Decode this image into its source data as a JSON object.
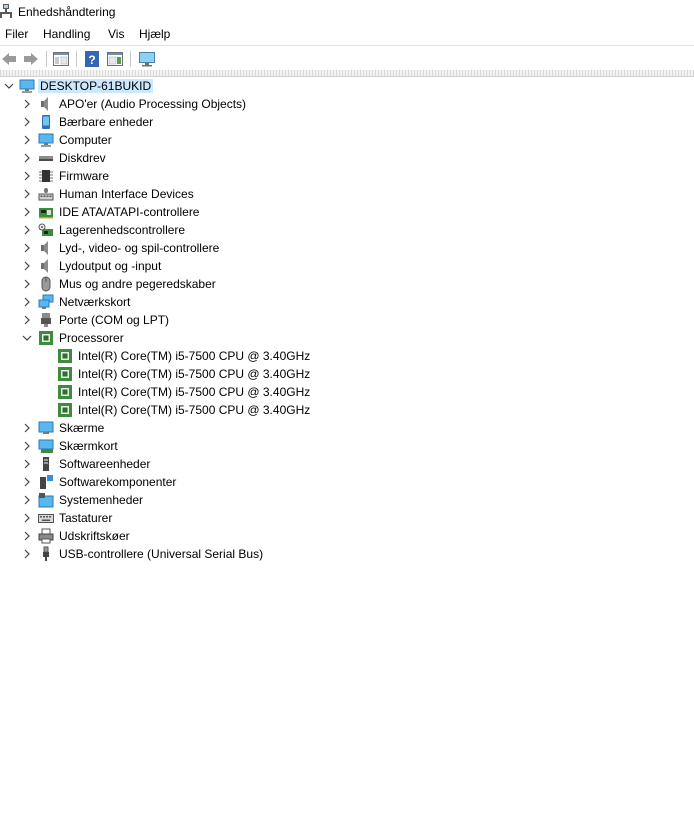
{
  "window": {
    "title": "Enhedshåndtering",
    "icon": "device-manager-icon"
  },
  "menu": [
    "Filer",
    "Handling",
    "Vis",
    "Hjælp"
  ],
  "toolbar": [
    {
      "name": "back-icon"
    },
    {
      "name": "forward-icon"
    },
    {
      "name": "properties-pane-icon"
    },
    {
      "name": "help-icon"
    },
    {
      "name": "action-pane-icon"
    },
    {
      "name": "scan-hardware-monitor-icon"
    }
  ],
  "tree": {
    "root": {
      "label": "DESKTOP-61BUKID",
      "icon": "computer-monitor-icon",
      "expanded": true
    },
    "categories": [
      {
        "label": "APO'er (Audio Processing Objects)",
        "icon": "speaker-icon"
      },
      {
        "label": "Bærbare enheder",
        "icon": "portable-device-icon"
      },
      {
        "label": "Computer",
        "icon": "computer-monitor-icon"
      },
      {
        "label": "Diskdrev",
        "icon": "disk-drive-icon"
      },
      {
        "label": "Firmware",
        "icon": "firmware-chip-icon"
      },
      {
        "label": "Human Interface Devices",
        "icon": "keyboard-hid-icon"
      },
      {
        "label": "IDE ATA/ATAPI-controllere",
        "icon": "ide-controller-icon"
      },
      {
        "label": "Lagerenhedscontrollere",
        "icon": "storage-controller-icon"
      },
      {
        "label": "Lyd-, video- og spil-controllere",
        "icon": "speaker-icon"
      },
      {
        "label": "Lydoutput og -input",
        "icon": "speaker-icon"
      },
      {
        "label": "Mus og andre pegeredskaber",
        "icon": "mouse-icon"
      },
      {
        "label": "Netværkskort",
        "icon": "network-adapter-icon"
      },
      {
        "label": "Porte (COM og LPT)",
        "icon": "port-icon"
      },
      {
        "label": "Processorer",
        "icon": "processor-icon",
        "expanded": true,
        "children": [
          {
            "label": "Intel(R) Core(TM) i5-7500 CPU @ 3.40GHz",
            "icon": "processor-icon"
          },
          {
            "label": "Intel(R) Core(TM) i5-7500 CPU @ 3.40GHz",
            "icon": "processor-icon"
          },
          {
            "label": "Intel(R) Core(TM) i5-7500 CPU @ 3.40GHz",
            "icon": "processor-icon"
          },
          {
            "label": "Intel(R) Core(TM) i5-7500 CPU @ 3.40GHz",
            "icon": "processor-icon"
          }
        ]
      },
      {
        "label": "Skærme",
        "icon": "monitor-icon"
      },
      {
        "label": "Skærmkort",
        "icon": "display-adapter-icon"
      },
      {
        "label": "Softwareenheder",
        "icon": "software-device-icon"
      },
      {
        "label": "Softwarekomponenter",
        "icon": "software-component-icon"
      },
      {
        "label": "Systemenheder",
        "icon": "system-devices-icon"
      },
      {
        "label": "Tastaturer",
        "icon": "keyboard-icon"
      },
      {
        "label": "Udskriftskøer",
        "icon": "printer-icon"
      },
      {
        "label": "USB-controllere (Universal Serial Bus)",
        "icon": "usb-icon"
      }
    ]
  }
}
